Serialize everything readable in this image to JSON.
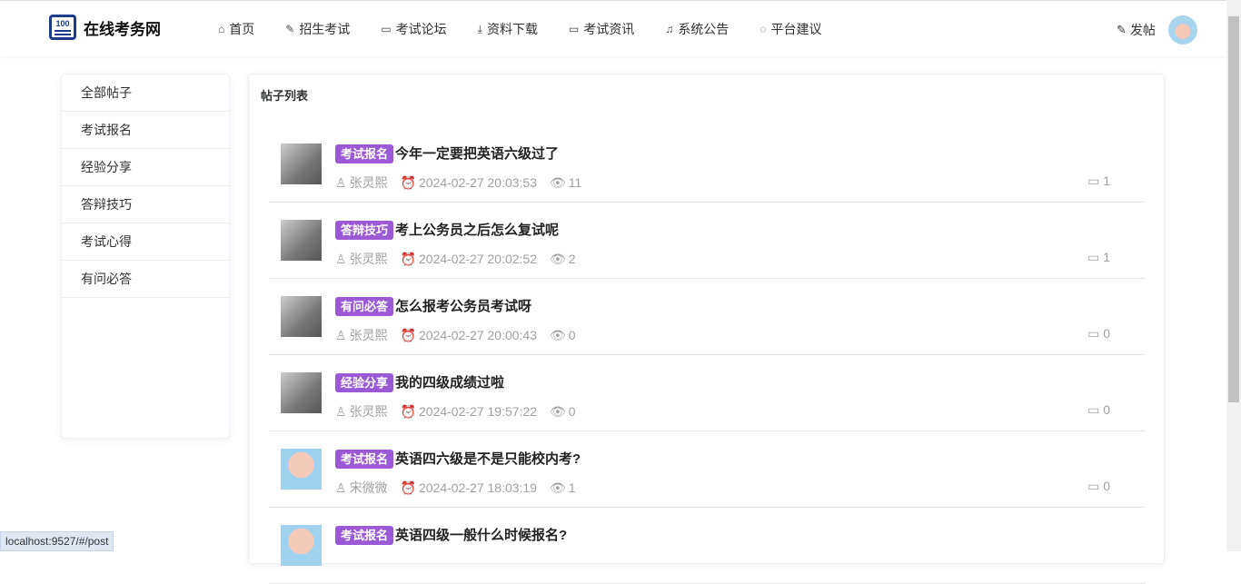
{
  "header": {
    "logo_number": "100",
    "logo_text": "在线考务网",
    "nav": [
      {
        "icon": "home-icon",
        "glyph": "⌂",
        "label": "首页"
      },
      {
        "icon": "edit-icon",
        "glyph": "✎",
        "label": "招生考试"
      },
      {
        "icon": "chat-icon",
        "glyph": "▭",
        "label": "考试论坛"
      },
      {
        "icon": "download-icon",
        "glyph": "⤓",
        "label": "资料下载"
      },
      {
        "icon": "chat-icon",
        "glyph": "▭",
        "label": "考试资讯"
      },
      {
        "icon": "bell-icon",
        "glyph": "♫",
        "label": "系统公告"
      },
      {
        "icon": "comment-icon",
        "glyph": "◌",
        "label": "平台建议"
      }
    ],
    "post_label": "发帖"
  },
  "sidebar": [
    "全部帖子",
    "考试报名",
    "经验分享",
    "答辩技巧",
    "考试心得",
    "有问必答"
  ],
  "main": {
    "title": "帖子列表",
    "posts": [
      {
        "tag": "考试报名",
        "title": "今年一定要把英语六级过了",
        "author": "张灵熙",
        "time": "2024-02-27 20:03:53",
        "views": "11",
        "comments": "1",
        "avatar": "cat"
      },
      {
        "tag": "答辩技巧",
        "title": "考上公务员之后怎么复试呢",
        "author": "张灵熙",
        "time": "2024-02-27 20:02:52",
        "views": "2",
        "comments": "1",
        "avatar": "cat"
      },
      {
        "tag": "有问必答",
        "title": "怎么报考公务员考试呀",
        "author": "张灵熙",
        "time": "2024-02-27 20:00:43",
        "views": "0",
        "comments": "0",
        "avatar": "cat"
      },
      {
        "tag": "经验分享",
        "title": "我的四级成绩过啦",
        "author": "张灵熙",
        "time": "2024-02-27 19:57:22",
        "views": "0",
        "comments": "0",
        "avatar": "cat"
      },
      {
        "tag": "考试报名",
        "title": "英语四六级是不是只能校内考?",
        "author": "宋微微",
        "time": "2024-02-27 18:03:19",
        "views": "1",
        "comments": "0",
        "avatar": "bunny"
      },
      {
        "tag": "考试报名",
        "title": "英语四级一般什么时候报名?",
        "author": "",
        "time": "",
        "views": "",
        "comments": "",
        "avatar": "bunny"
      }
    ]
  },
  "status_url": "localhost:9527/#/post"
}
